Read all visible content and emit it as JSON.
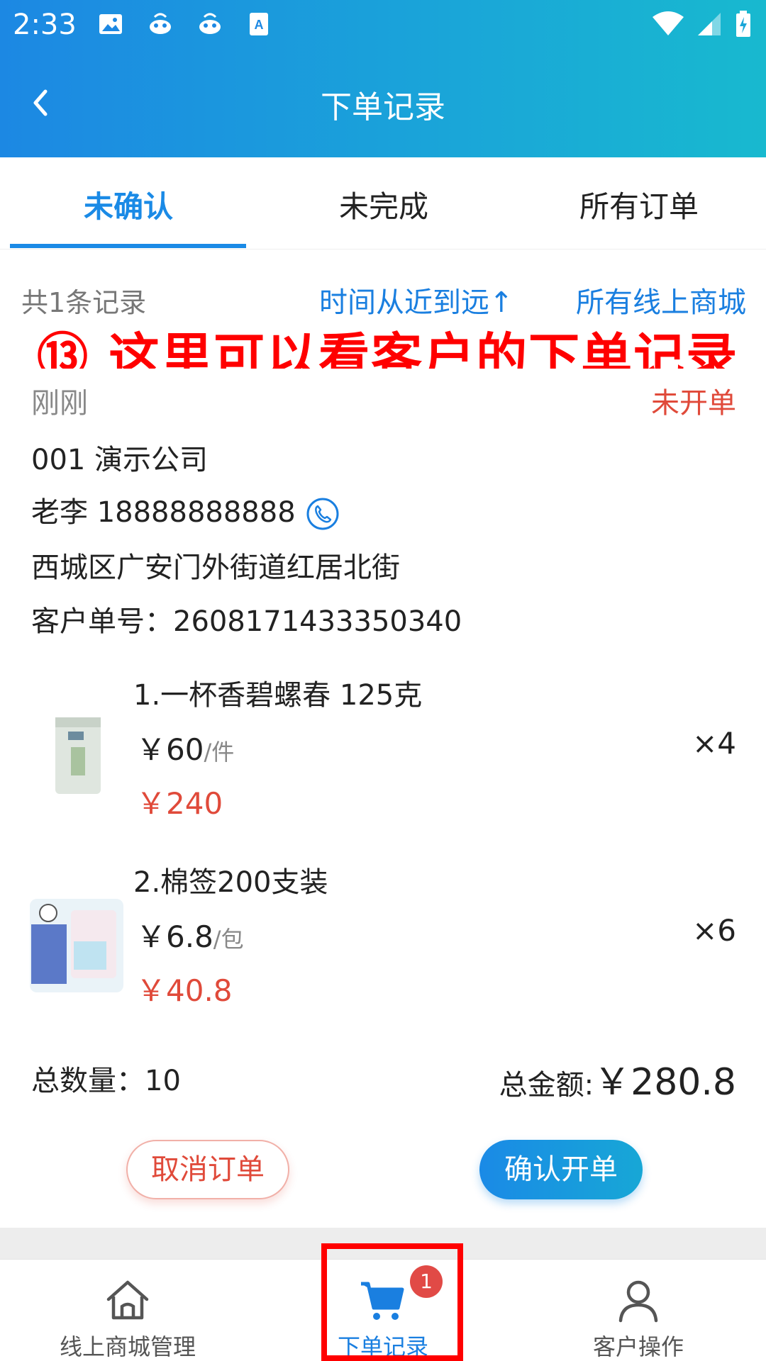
{
  "status_bar": {
    "time": "2:33"
  },
  "header": {
    "title": "下单记录"
  },
  "tabs": [
    {
      "label": "未确认"
    },
    {
      "label": "未完成"
    },
    {
      "label": "所有订单"
    }
  ],
  "summary": {
    "count_text": "共1条记录",
    "sort_text": "时间从近到远↑",
    "mall_filter": "所有线上商城"
  },
  "annotation": "⑬ 这里可以看客户的下单记录",
  "order": {
    "time": "刚刚",
    "status": "未开单",
    "customer": "001 演示公司",
    "contact": "老李 18888888888",
    "address": "西城区广安门外街道红居北街",
    "order_no": "客户单号：2608171433350340",
    "items": [
      {
        "name": "1.一杯香碧螺春 125克",
        "price": "￥60",
        "unit": "/件",
        "qty": "×4",
        "subtotal": "￥240"
      },
      {
        "name": "2.棉签200支装",
        "price": "￥6.8",
        "unit": "/包",
        "qty": "×6",
        "subtotal": "￥40.8"
      }
    ],
    "total_qty": "总数量：10",
    "total_amount_label": "总金额:",
    "total_amount": "￥280.8",
    "cancel_label": "取消订单",
    "confirm_label": "确认开单"
  },
  "bottom_nav": [
    {
      "label": "线上商城管理",
      "icon": "home-icon"
    },
    {
      "label": "下单记录",
      "icon": "cart-icon",
      "badge": "1"
    },
    {
      "label": "客户操作",
      "icon": "person-icon"
    }
  ],
  "colors": {
    "accent": "#1a8ae6",
    "danger": "#e04a3a",
    "annotation": "#ff0000"
  }
}
